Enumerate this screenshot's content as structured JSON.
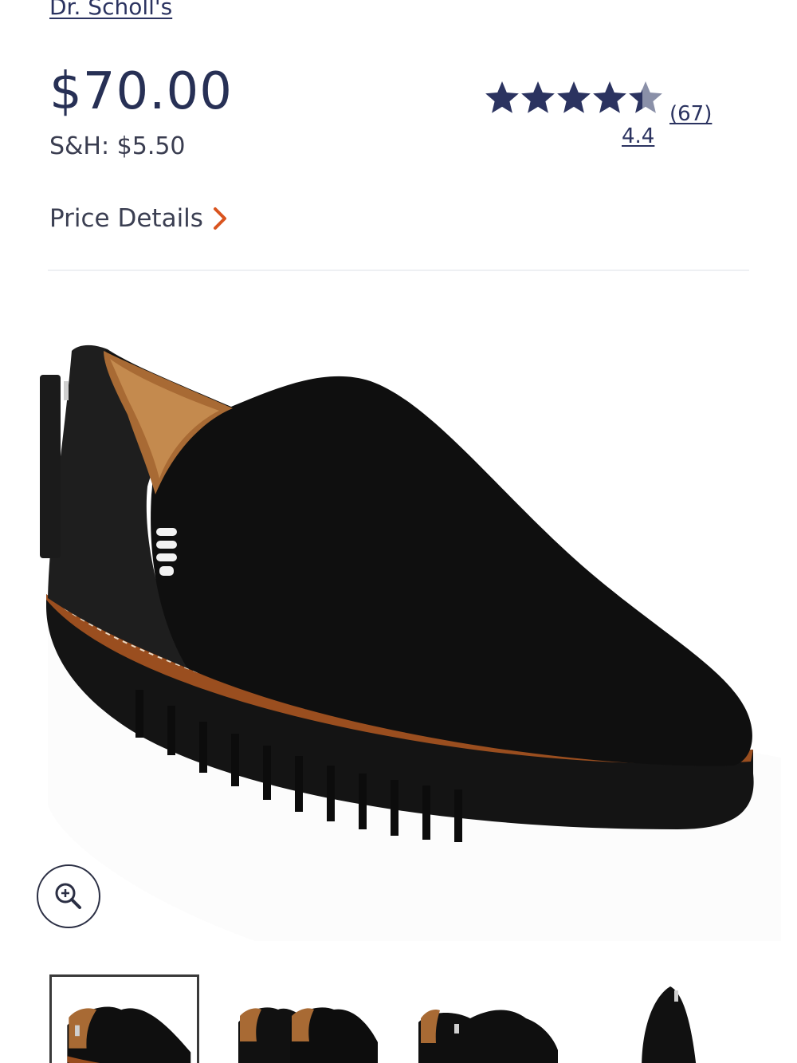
{
  "product": {
    "brand": "Dr. Scholl's",
    "price": "$70.00",
    "shipping": "S&H: $5.50"
  },
  "rating": {
    "value": "4.4",
    "count": "(67)",
    "stars": 4.4,
    "max_stars": 5,
    "star_color": "#2b3360",
    "star_partial_color": "#8a90a8"
  },
  "price_details": {
    "label": "Price Details",
    "chevron_color": "#d9541f"
  },
  "gallery": {
    "zoom_icon": "zoom-in-icon",
    "thumbnail_count": 4,
    "selected_index": 0
  }
}
